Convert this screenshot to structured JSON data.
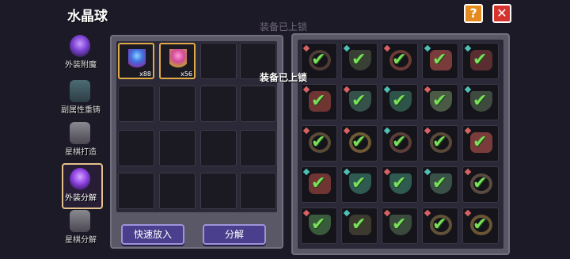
{
  "header": {
    "title": "水晶球",
    "help_label": "?",
    "close_label": "✕",
    "watermark": "装备已上锁"
  },
  "toast": {
    "text": "装备已上锁"
  },
  "sidebar": {
    "items": [
      {
        "label": "外装附魔",
        "icon": "enchant-orb-icon",
        "active": false
      },
      {
        "label": "副属性重铸",
        "icon": "recast-figure-icon",
        "active": false
      },
      {
        "label": "星棋打造",
        "icon": "forge-figure-icon",
        "active": false
      },
      {
        "label": "外装分解",
        "icon": "disassemble-orb-icon",
        "active": true
      },
      {
        "label": "星棋分解",
        "icon": "chess-disassemble-icon",
        "active": false
      }
    ]
  },
  "materials": {
    "slots": [
      {
        "icon": "blue-crystal-icon",
        "count": "x88"
      },
      {
        "icon": "pink-crystal-icon",
        "count": "x56"
      }
    ]
  },
  "actions": {
    "quick_add_label": "快速放入",
    "decompose_label": "分解"
  },
  "equipment": {
    "rows": [
      [
        {
          "icon": "ring-icon",
          "color": "#4d3b35",
          "pip": "#d86262"
        },
        {
          "icon": "pendant-icon",
          "color": "#3a3f35",
          "pip": "#4ec0b6"
        },
        {
          "icon": "ring-icon",
          "color": "#6b3a35",
          "pip": "#d86262"
        },
        {
          "icon": "heart-icon",
          "color": "#7a3b3b",
          "pip": "#4ec0b6"
        },
        {
          "icon": "heart-icon",
          "color": "#5a2e30",
          "pip": "#4ec0b6"
        }
      ],
      [
        {
          "icon": "heart-icon",
          "color": "#6e3533",
          "pip": "#d86262"
        },
        {
          "icon": "pendant-icon",
          "color": "#36504a",
          "pip": "#d86262"
        },
        {
          "icon": "pendant-icon",
          "color": "#2e5348",
          "pip": "#4ec0b6"
        },
        {
          "icon": "pendant-icon",
          "color": "#4b5a45",
          "pip": "#d86262"
        },
        {
          "icon": "pendant-icon",
          "color": "#3f4a3e",
          "pip": "#4ec0b6"
        }
      ],
      [
        {
          "icon": "ring-icon",
          "color": "#5a4a36",
          "pip": "#d86262"
        },
        {
          "icon": "ring-icon",
          "color": "#6d5a34",
          "pip": "#d86262"
        },
        {
          "icon": "ring-icon",
          "color": "#5c3e38",
          "pip": "#4ec0b6"
        },
        {
          "icon": "ring-icon",
          "color": "#5a4838",
          "pip": "#d86262"
        },
        {
          "icon": "heart-icon",
          "color": "#7a3b3b",
          "pip": "#d86262"
        }
      ],
      [
        {
          "icon": "heart-icon",
          "color": "#6e3533",
          "pip": "#4ec0b6"
        },
        {
          "icon": "pendant-icon",
          "color": "#2e5a52",
          "pip": "#4ec0b6"
        },
        {
          "icon": "pendant-icon",
          "color": "#2f5a50",
          "pip": "#d86262"
        },
        {
          "icon": "pendant-icon",
          "color": "#3a5148",
          "pip": "#4ec0b6"
        },
        {
          "icon": "ring-icon",
          "color": "#5a4a40",
          "pip": "#d86262"
        }
      ],
      [
        {
          "icon": "pendant-icon",
          "color": "#3a5a3c",
          "pip": "#d86262"
        },
        {
          "icon": "heart-icon",
          "color": "#3c3a2f",
          "pip": "#4ec0b6"
        },
        {
          "icon": "pendant-icon",
          "color": "#3a4a3c",
          "pip": "#d86262"
        },
        {
          "icon": "ring-icon",
          "color": "#5f5236",
          "pip": "#d86262"
        },
        {
          "icon": "ring-icon",
          "color": "#6a5534",
          "pip": "#d86262"
        }
      ]
    ],
    "check_glyph": "✔"
  },
  "colors": {
    "accent_gold": "#e1a94a",
    "button_purple": "#4a3f8c",
    "check_green": "#78e05a",
    "help_orange": "#e58a1f",
    "close_red": "#d6332e"
  }
}
